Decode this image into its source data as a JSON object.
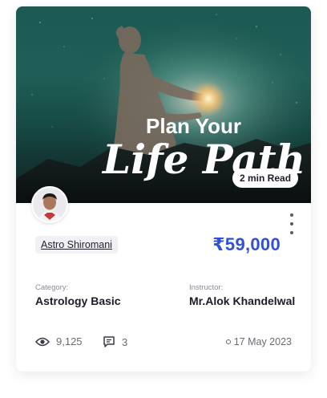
{
  "card": {
    "hero": {
      "line1": "Plan Your",
      "line2": "Life Path",
      "badge": "2 min Read"
    },
    "menu_icon": "more-vertical-icon",
    "category_tag": "Astro Shiromani",
    "price": "₹59,000",
    "category": {
      "label": "Category:",
      "value": "Astrology Basic"
    },
    "instructor": {
      "label": "Instructor:",
      "value": "Mr.Alok Khandelwal"
    },
    "stats": {
      "views_icon": "eye-icon",
      "views": "9,125",
      "comments_icon": "comment-icon",
      "comments": "3",
      "date": "17 May 2023"
    },
    "colors": {
      "accent": "#3050d6",
      "text": "#1c1c28",
      "muted": "#8a8a94"
    }
  }
}
